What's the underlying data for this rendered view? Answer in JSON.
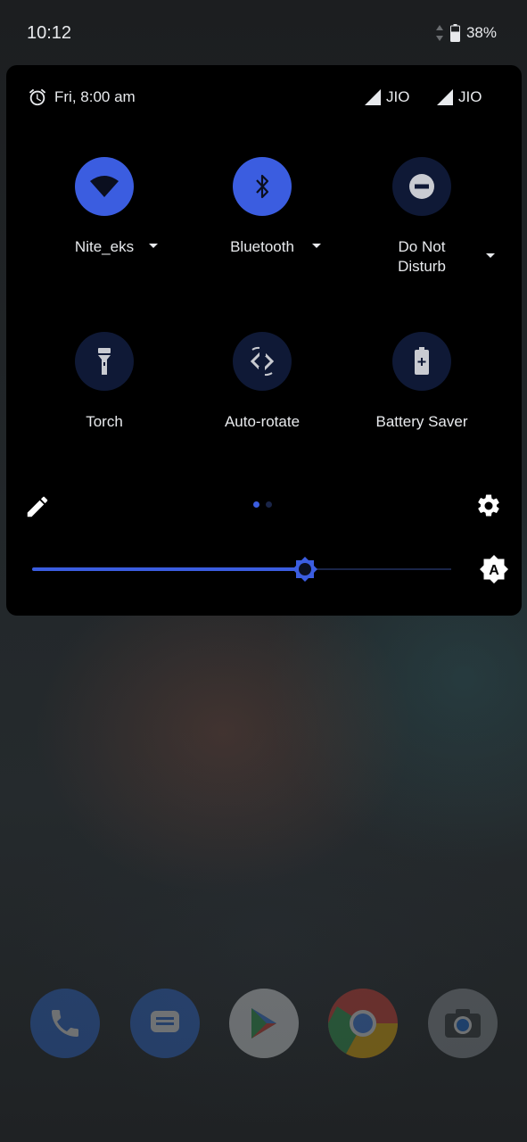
{
  "status_bar": {
    "time": "10:12",
    "battery": "38%"
  },
  "header": {
    "alarm": "Fri, 8:00 am",
    "sim1": "JIO",
    "sim2": "JIO"
  },
  "tiles": [
    {
      "label": "Nite_eks",
      "state": "on",
      "icon": "wifi-icon"
    },
    {
      "label": "Bluetooth",
      "state": "on",
      "icon": "bluetooth-icon"
    },
    {
      "label_line1": "Do Not",
      "label_line2": "Disturb",
      "state": "off",
      "icon": "do-not-disturb-icon"
    },
    {
      "label": "Torch",
      "state": "off",
      "icon": "torch-icon"
    },
    {
      "label": "Auto-rotate",
      "state": "off",
      "icon": "auto-rotate-icon"
    },
    {
      "label": "Battery Saver",
      "state": "off",
      "icon": "battery-saver-icon"
    }
  ],
  "brightness": {
    "level": 0.65,
    "auto_label": "A"
  },
  "pager": {
    "pages": 2,
    "current": 1
  },
  "colors": {
    "accent": "#3b5de0",
    "tile_off": "#0f1936",
    "panel": "#000000"
  },
  "dock": [
    "phone-icon",
    "messages-icon",
    "play-store-icon",
    "chrome-icon",
    "camera-icon"
  ]
}
